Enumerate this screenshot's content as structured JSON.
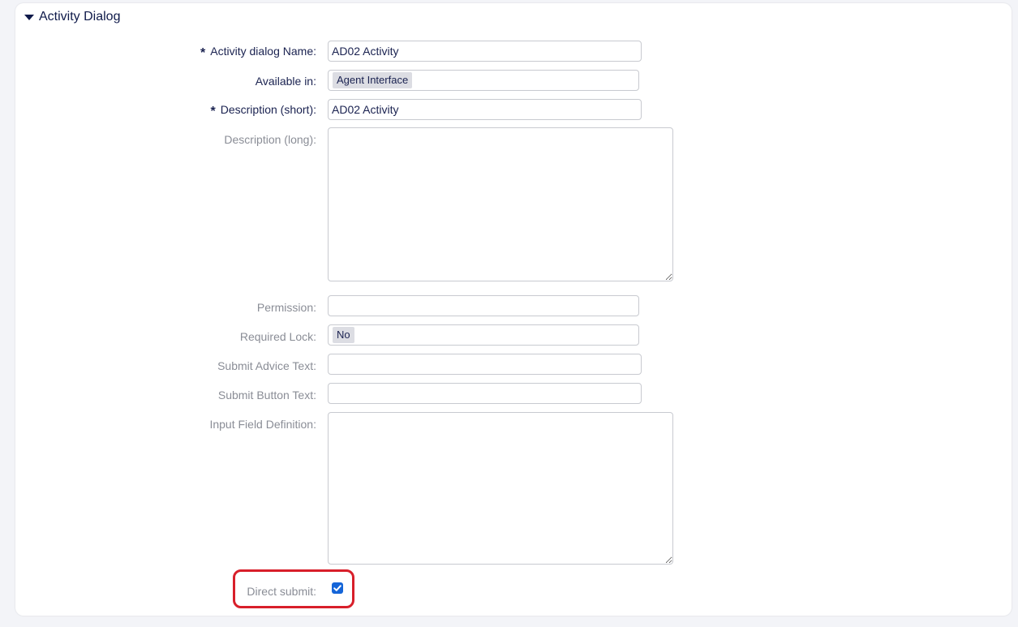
{
  "panel": {
    "title": "Activity Dialog"
  },
  "form": {
    "activity_dialog_name": {
      "label": "Activity dialog Name:",
      "value": "AD02 Activity",
      "required": true
    },
    "available_in": {
      "label": "Available in:",
      "value": "Agent Interface"
    },
    "description_short": {
      "label": "Description (short):",
      "value": "AD02 Activity",
      "required": true
    },
    "description_long": {
      "label": "Description (long):",
      "value": ""
    },
    "permission": {
      "label": "Permission:",
      "value": ""
    },
    "required_lock": {
      "label": "Required Lock:",
      "value": "No"
    },
    "submit_advice_text": {
      "label": "Submit Advice Text:",
      "value": ""
    },
    "submit_button_text": {
      "label": "Submit Button Text:",
      "value": ""
    },
    "input_field_definition": {
      "label": "Input Field Definition:",
      "value": ""
    },
    "direct_submit": {
      "label": "Direct submit:",
      "checked": true
    }
  },
  "colors": {
    "accent": "#1565d8",
    "highlight": "#d81f2a",
    "title": "#0f1a4a",
    "muted_label": "#8a8d96"
  },
  "required_marker": "*"
}
